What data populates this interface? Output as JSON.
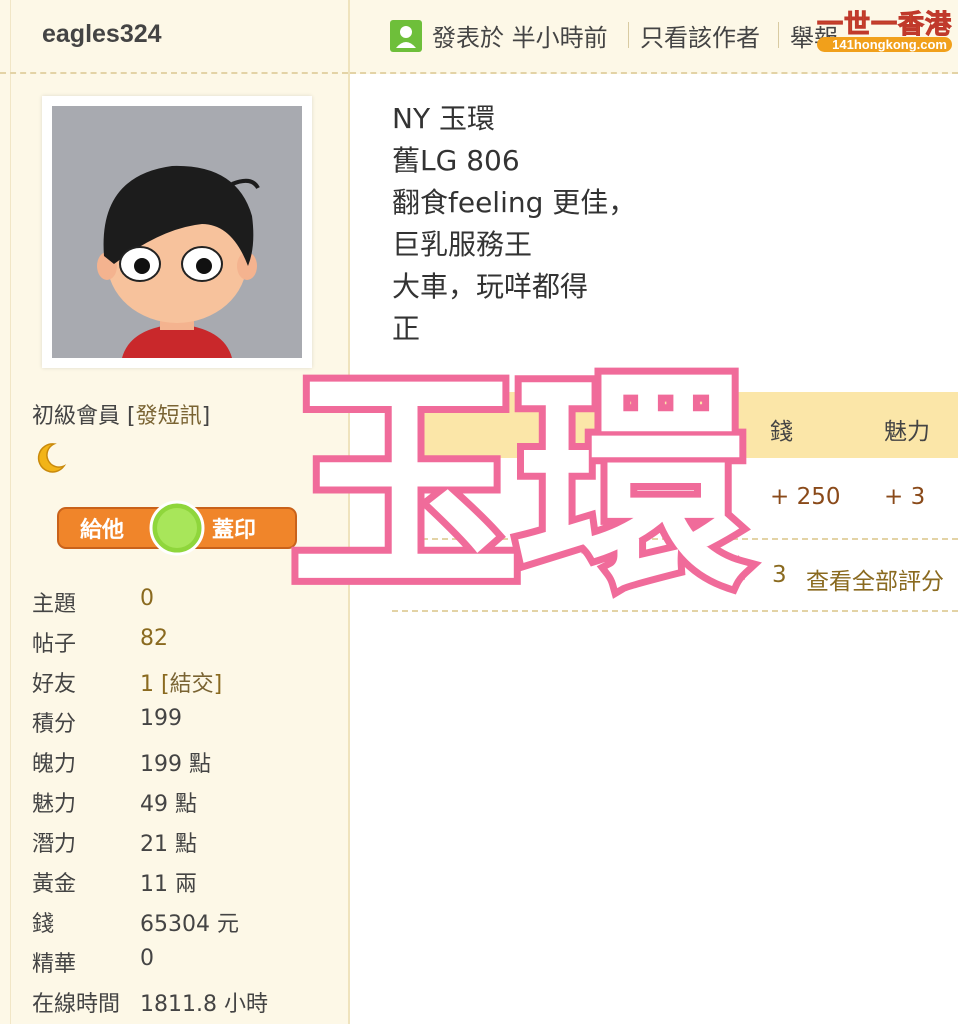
{
  "user": {
    "username": "eagles324",
    "rank": "初級會員",
    "pm_link": "發短訊",
    "stamp_left": "給他",
    "stamp_right": "蓋印",
    "stats": [
      {
        "label": "主題",
        "value": "0"
      },
      {
        "label": "帖子",
        "value": "82"
      },
      {
        "label": "好友",
        "value": "1",
        "link": "結交"
      },
      {
        "label": "積分",
        "value": "199"
      },
      {
        "label": "魄力",
        "value": "199 點"
      },
      {
        "label": "魅力",
        "value": "49 點"
      },
      {
        "label": "潛力",
        "value": "21 點"
      },
      {
        "label": "黃金",
        "value": "11 兩"
      },
      {
        "label": "錢",
        "value": "65304 元"
      },
      {
        "label": "精華",
        "value": "0"
      },
      {
        "label": "在線時間",
        "value": "1811.8 小時"
      }
    ]
  },
  "post_header": {
    "posted": "發表於 半小時前",
    "only_author": "只看該作者",
    "report": "舉報",
    "brand_main": "一世一香港",
    "brand_sub": "141hongkong.com"
  },
  "post": {
    "lines": [
      "NY 玉環",
      "舊LG 806",
      "翻食feeling 更佳，",
      "巨乳服務王",
      "大車，玩咩都得",
      "正"
    ]
  },
  "rating": {
    "col_money": "錢",
    "col_charm": "魅力",
    "row_money": "+ 250",
    "row_charm": "+ 3",
    "count": "3",
    "view_all": "查看全部評分"
  },
  "overlay_text": "玉環",
  "colors": {
    "overlay_stroke": "#f06b9a",
    "panel_bg": "#fdf8e7",
    "rate_header_bg": "#fbe6a8"
  }
}
